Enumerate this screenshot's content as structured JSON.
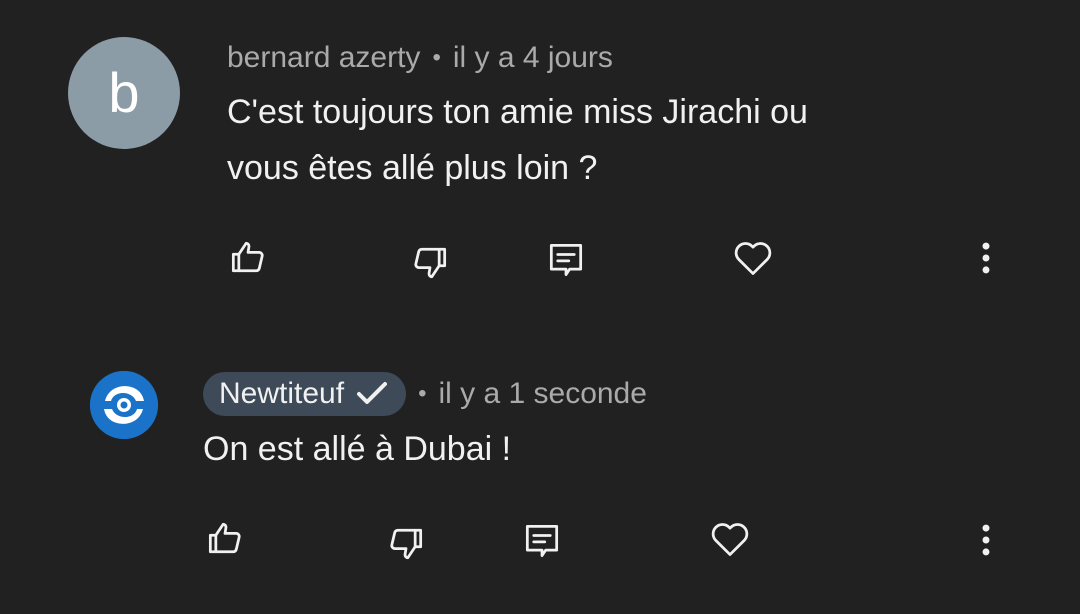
{
  "comments": [
    {
      "avatar_letter": "b",
      "author": "bernard azerty",
      "separator": "•",
      "time": "il y a 4 jours",
      "text_line1": "C'est toujours ton amie miss Jirachi ou",
      "text_line2": "vous êtes allé plus loin ?",
      "actions": [
        "thumb-up-icon",
        "thumb-down-icon",
        "reply-icon",
        "heart-icon",
        "more-vert-icon"
      ]
    },
    {
      "avatar_icon": "channel-logo-icon",
      "author": "Newtiteuf",
      "verified_icon": "checkmark-icon",
      "separator": "•",
      "time": "il y a 1 seconde",
      "text": "On est allé à Dubai !",
      "actions": [
        "thumb-up-icon",
        "thumb-down-icon",
        "reply-icon",
        "heart-icon",
        "more-vert-icon"
      ]
    }
  ],
  "colors": {
    "background": "#212121",
    "text": "#f1f1f1",
    "meta": "#aaaaaa",
    "avatar_letter_bg": "#8c9ca6",
    "author_chip_bg": "#3e4a58",
    "logo_blue": "#1a73c8"
  }
}
